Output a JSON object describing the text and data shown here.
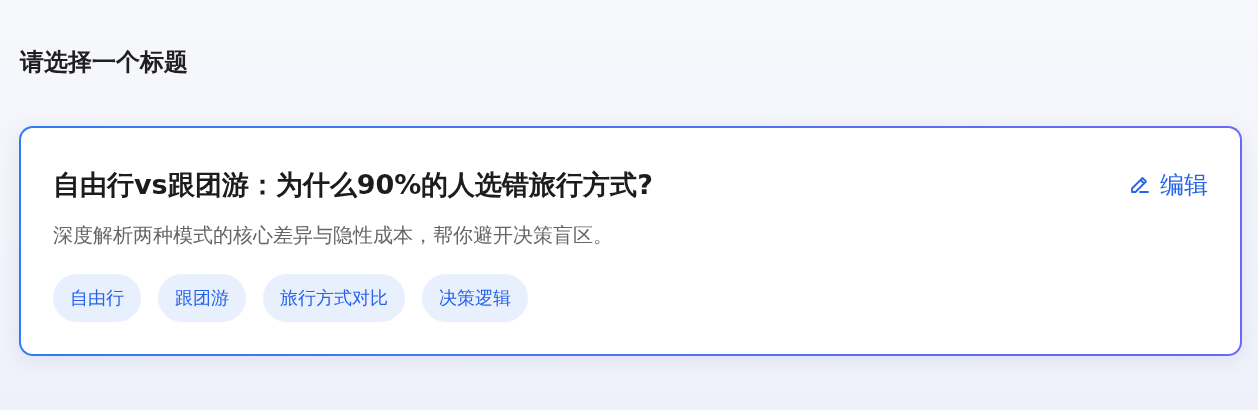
{
  "heading": "请选择一个标题",
  "options": [
    {
      "title": "自由行vs跟团游：为什么90%的人选错旅行方式?",
      "edit_label": "编辑",
      "description": "深度解析两种模式的核心差异与隐性成本，帮你避开决策盲区。",
      "selected": true,
      "tags": [
        "自由行",
        "跟团游",
        "旅行方式对比",
        "决策逻辑"
      ]
    }
  ]
}
